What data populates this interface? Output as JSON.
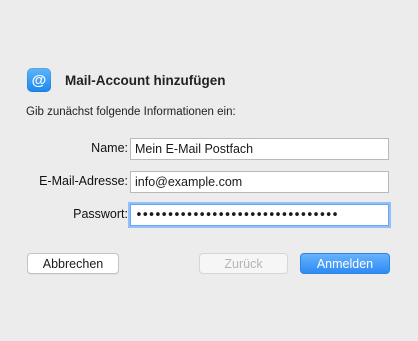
{
  "dialog": {
    "icon_symbol": "@",
    "icon_name": "mail-at-icon",
    "title": "Mail-Account hinzufügen",
    "instructions": "Gib zunächst folgende Informationen ein:"
  },
  "form": {
    "name": {
      "label": "Name:",
      "value": "Mein E-Mail Postfach"
    },
    "email": {
      "label": "E-Mail-Adresse:",
      "value": "info@example.com"
    },
    "password": {
      "label": "Passwort:",
      "masked_value": "••••••••••••••••••••••••••••••••"
    }
  },
  "buttons": {
    "cancel": "Abbrechen",
    "back": "Zurück",
    "sign_in": "Anmelden"
  },
  "colors": {
    "accent": "#2d8bf5",
    "icon_bg": "#1b87ee",
    "background": "#ececec"
  }
}
